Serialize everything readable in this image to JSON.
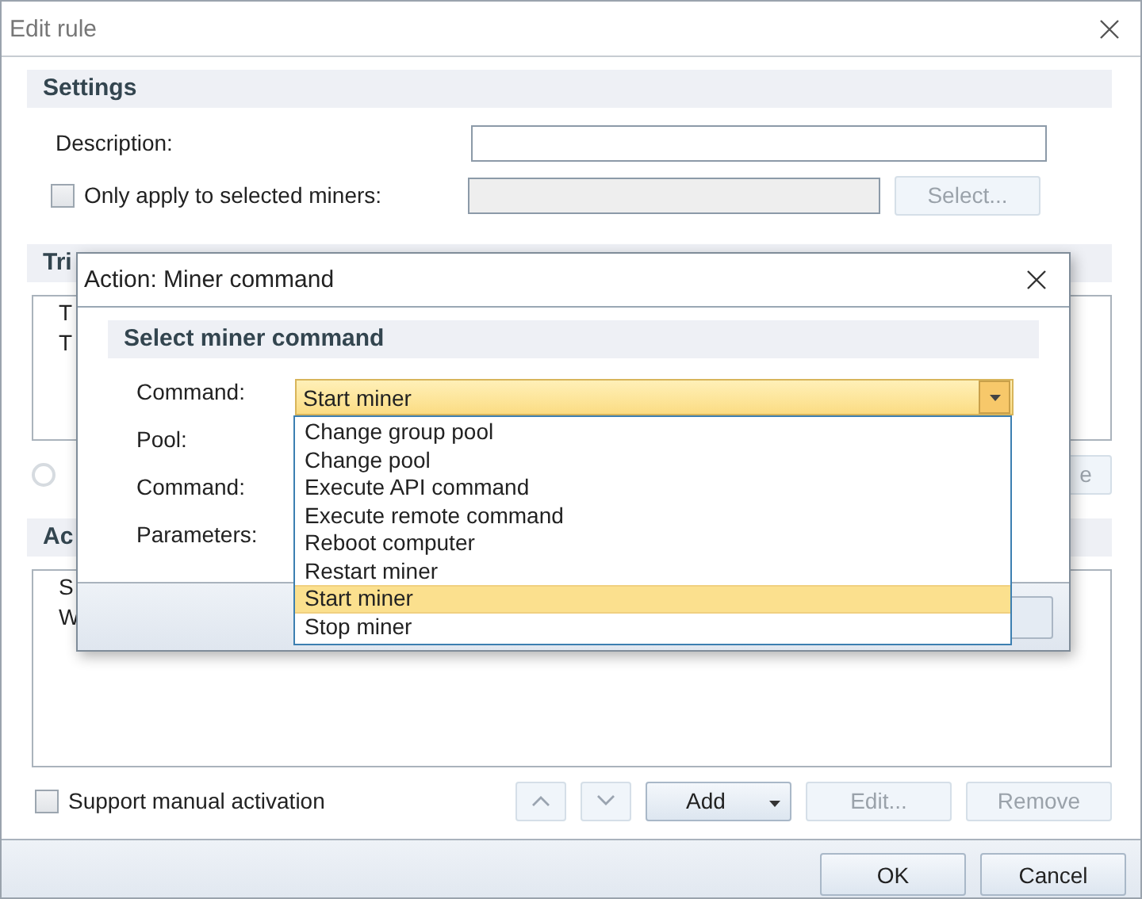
{
  "window": {
    "title": "Edit rule"
  },
  "settings": {
    "header": "Settings",
    "description_label": "Description:",
    "only_selected": {
      "label": "Only apply to selected miners:",
      "checked": false
    },
    "select_button": {
      "label": "Select...",
      "disabled": true
    }
  },
  "triggers": {
    "header": "Tri",
    "lines": [
      "T",
      "T"
    ]
  },
  "trigger_radio": {
    "selected": false
  },
  "trigger_button": {
    "label": "e",
    "disabled": true
  },
  "actions": {
    "header": "Ac",
    "lines": [
      "S",
      "W"
    ]
  },
  "manual_activation": {
    "label": "Support manual activation",
    "checked": false
  },
  "action_buttons": [
    {
      "kind": "up",
      "disabled": true
    },
    {
      "kind": "down",
      "disabled": true
    },
    {
      "kind": "add",
      "label": "Add",
      "disabled": false
    },
    {
      "kind": "plain",
      "label": "Edit...",
      "disabled": true
    },
    {
      "kind": "plain",
      "label": "Remove",
      "disabled": true
    }
  ],
  "footer_buttons": [
    "OK",
    "Cancel"
  ],
  "dialog": {
    "title": "Action: Miner command",
    "header": "Select miner command",
    "labels": [
      "Command:",
      "Pool:",
      "Command:",
      "Parameters:"
    ],
    "command": {
      "value": "Start miner",
      "expanded": true,
      "options": [
        {
          "label": "Change group pool",
          "selected": false
        },
        {
          "label": "Change pool",
          "selected": false
        },
        {
          "label": "Execute API command",
          "selected": false
        },
        {
          "label": "Execute remote command",
          "selected": false
        },
        {
          "label": "Reboot computer",
          "selected": false
        },
        {
          "label": "Restart miner",
          "selected": false
        },
        {
          "label": "Start miner",
          "selected": true
        },
        {
          "label": "Stop miner",
          "selected": false
        }
      ]
    }
  }
}
